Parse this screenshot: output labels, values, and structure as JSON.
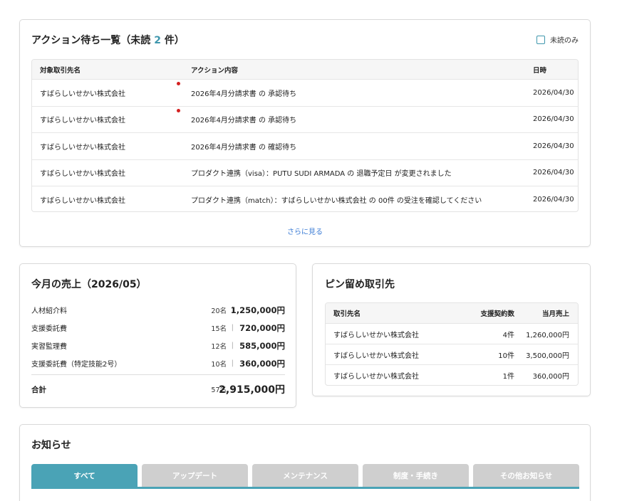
{
  "action_list": {
    "title_prefix": "アクション待ち一覧（未読",
    "unread_count": "2",
    "title_suffix": "件）",
    "unread_only_label": "未読のみ",
    "columns": {
      "company": "対象取引先名",
      "action": "アクション内容",
      "date": "日時"
    },
    "rows": [
      {
        "company": "すばらしいせかい株式会社",
        "action": "2026年4月分請求書 の 承認待ち",
        "date": "2026/04/30",
        "unread": true
      },
      {
        "company": "すばらしいせかい株式会社",
        "action": "2026年4月分請求書 の 承認待ち",
        "date": "2026/04/30",
        "unread": true
      },
      {
        "company": "すばらしいせかい株式会社",
        "action": "2026年4月分請求書 の 確認待ち",
        "date": "2026/04/30",
        "unread": false
      },
      {
        "company": "すばらしいせかい株式会社",
        "action": "プロダクト連携（visa）：PUTU SUDI ARMADA の 退職予定日 が変更されました",
        "date": "2026/04/30",
        "unread": false
      },
      {
        "company": "すばらしいせかい株式会社",
        "action": "プロダクト連携（match）：すばらしいせかい株式会社 の 00件 の受注を確認してください",
        "date": "2026/04/30",
        "unread": false
      }
    ],
    "more_label": "さらに見る"
  },
  "sales": {
    "title": "今月の売上（2026/05）",
    "items": [
      {
        "label": "人材紹介料",
        "count": "20名",
        "amount": "1,250,000円"
      },
      {
        "label": "支援委託費",
        "count": "15名",
        "amount": "720,000円"
      },
      {
        "label": "実習監理費",
        "count": "12名",
        "amount": "585,000円"
      },
      {
        "label": "支援委託費（特定技能2号）",
        "count": "10名",
        "amount": "360,000円"
      }
    ],
    "separator": "|",
    "total": {
      "label": "合計",
      "count": "57名",
      "amount": "2,915,000円"
    }
  },
  "pinned": {
    "title": "ピン留め取引先",
    "columns": {
      "name": "取引先名",
      "contracts": "支援契約数",
      "sales": "当月売上"
    },
    "rows": [
      {
        "name": "すばらしいせかい株式会社",
        "contracts": "4件",
        "sales": "1,260,000円"
      },
      {
        "name": "すばらしいせかい株式会社",
        "contracts": "10件",
        "sales": "3,500,000円"
      },
      {
        "name": "すばらしいせかい株式会社",
        "contracts": "1件",
        "sales": "360,000円"
      }
    ]
  },
  "news": {
    "title": "お知らせ",
    "tabs": [
      {
        "label": "すべて",
        "active": true
      },
      {
        "label": "アップデート",
        "active": false
      },
      {
        "label": "メンテナンス",
        "active": false
      },
      {
        "label": "制度・手続き",
        "active": false
      },
      {
        "label": "その他お知らせ",
        "active": false
      }
    ]
  },
  "colors": {
    "accent": "#4aa3b6",
    "unread_dot": "#d42020",
    "link": "#3a7bd5"
  }
}
